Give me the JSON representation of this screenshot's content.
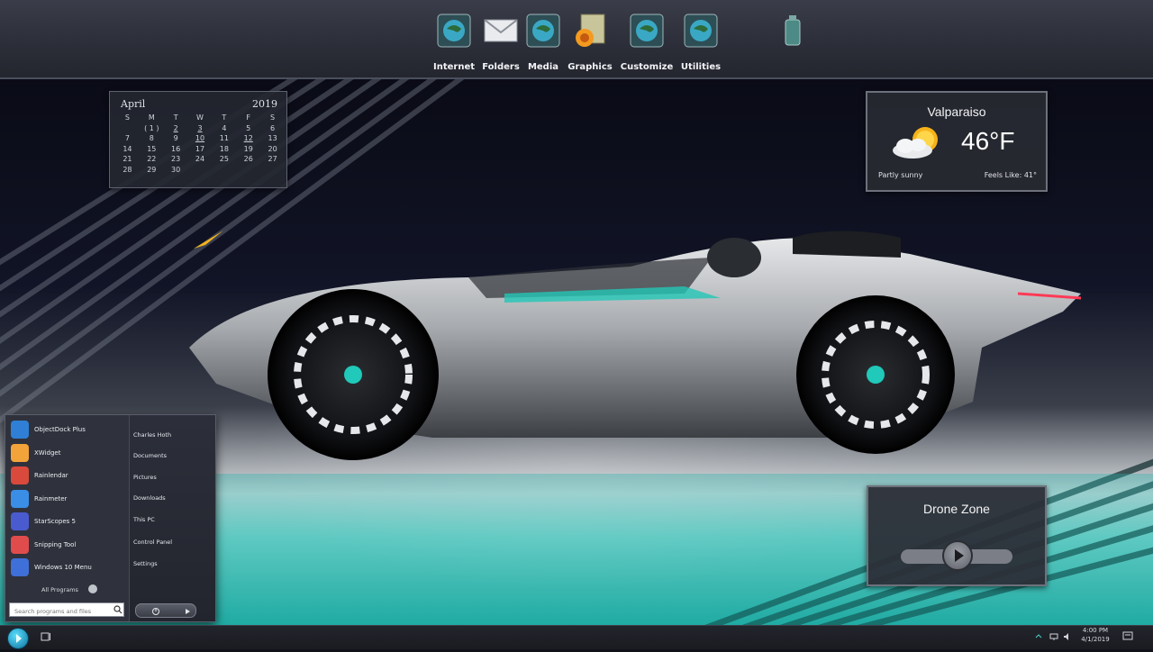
{
  "dock": {
    "items": [
      {
        "label": "Internet",
        "icon": "globe-icon"
      },
      {
        "label": "Folders",
        "icon": "envelope-icon"
      },
      {
        "label": "Media",
        "icon": "globe-icon"
      },
      {
        "label": "Graphics",
        "icon": "graphics-folder-icon"
      },
      {
        "label": "Customize",
        "icon": "globe-icon"
      },
      {
        "label": "Utilities",
        "icon": "recycle-bin-icon"
      }
    ]
  },
  "calendar": {
    "month": "April",
    "year": "2019",
    "weekdays": [
      "S",
      "M",
      "T",
      "W",
      "T",
      "F",
      "S"
    ],
    "weeks": [
      [
        "",
        "( 1 )",
        "2",
        "3",
        "4",
        "5",
        "6"
      ],
      [
        "7",
        "8",
        "9",
        "10",
        "11",
        "12",
        "13"
      ],
      [
        "14",
        "15",
        "16",
        "17",
        "18",
        "19",
        "20"
      ],
      [
        "21",
        "22",
        "23",
        "24",
        "25",
        "26",
        "27"
      ],
      [
        "28",
        "29",
        "30",
        "",
        "",
        "",
        ""
      ]
    ],
    "underlined_days": [
      "2",
      "3",
      "10",
      "12"
    ]
  },
  "weather": {
    "city": "Valparaiso",
    "temperature": "46°F",
    "condition": "Partly sunny",
    "feels_like": "Feels Like: 41°",
    "icon": "partly-sunny-icon"
  },
  "music": {
    "title": "Drone Zone",
    "play_icon": "play-icon"
  },
  "start_menu": {
    "programs": [
      {
        "label": "ObjectDock Plus",
        "icon": "objectdock-icon",
        "color": "#2f7fd6"
      },
      {
        "label": "XWidget",
        "icon": "xwidget-icon",
        "color": "#f2a43a"
      },
      {
        "label": "Rainlendar",
        "icon": "rainlendar-icon",
        "color": "#d94a3c"
      },
      {
        "label": "Rainmeter",
        "icon": "rainmeter-icon",
        "color": "#3a8ee6"
      },
      {
        "label": "StarScopes 5",
        "icon": "starscopes-icon",
        "color": "#4a5bd0"
      },
      {
        "label": "Snipping Tool",
        "icon": "snipping-tool-icon",
        "color": "#e04c4c"
      },
      {
        "label": "Windows 10 Menu",
        "icon": "windows-menu-icon",
        "color": "#3f6fd8"
      }
    ],
    "all_programs": "All Programs",
    "places": [
      "Charles Hoth",
      "Documents",
      "Pictures",
      "Downloads",
      "This PC",
      "Control Panel",
      "Settings"
    ],
    "search_placeholder": "Search programs and files"
  },
  "taskbar": {
    "time": "4:00 PM",
    "date": "4/1/2019"
  }
}
